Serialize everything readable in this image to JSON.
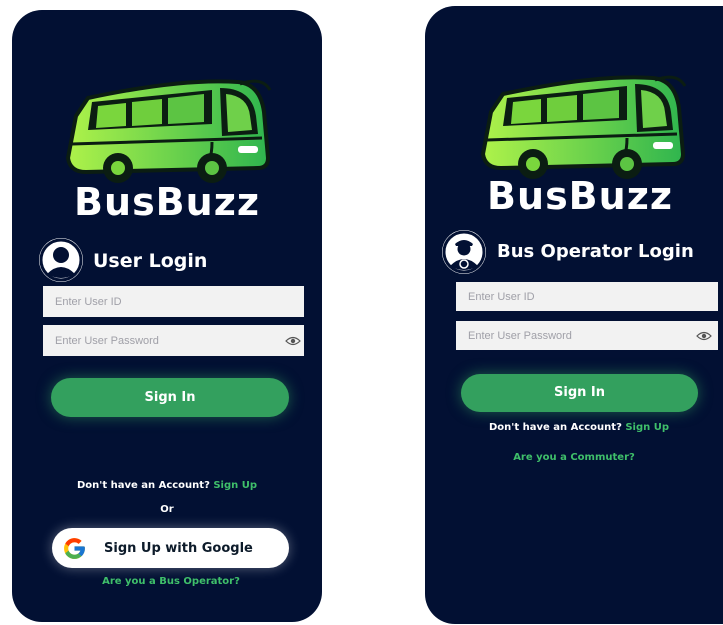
{
  "colors": {
    "background": "#021033",
    "accent": "#33a05e",
    "link": "#3fbf6a",
    "field": "#f2f2f2"
  },
  "user_screen": {
    "brand": "BusBuzz",
    "avatar_icon": "user-avatar-icon",
    "title": "User Login",
    "user_id_placeholder": "Enter User ID",
    "password_placeholder": "Enter User Password",
    "password_toggle_icon": "eye-icon",
    "sign_in_label": "Sign In",
    "no_account_text": "Don't have an Account?",
    "sign_up_link": "Sign Up",
    "or_text": "Or",
    "google_label": "Sign Up with Google",
    "google_icon": "google-g-icon",
    "operator_link": "Are you a Bus Operator?"
  },
  "operator_screen": {
    "brand": "BusBuzz",
    "avatar_icon": "bus-driver-avatar-icon",
    "title": "Bus Operator Login",
    "user_id_placeholder": "Enter User ID",
    "password_placeholder": "Enter User Password",
    "password_toggle_icon": "eye-icon",
    "sign_in_label": "Sign In",
    "no_account_text": "Don't have an Account?",
    "sign_up_link": "Sign Up",
    "commuter_link": "Are you a Commuter?"
  }
}
